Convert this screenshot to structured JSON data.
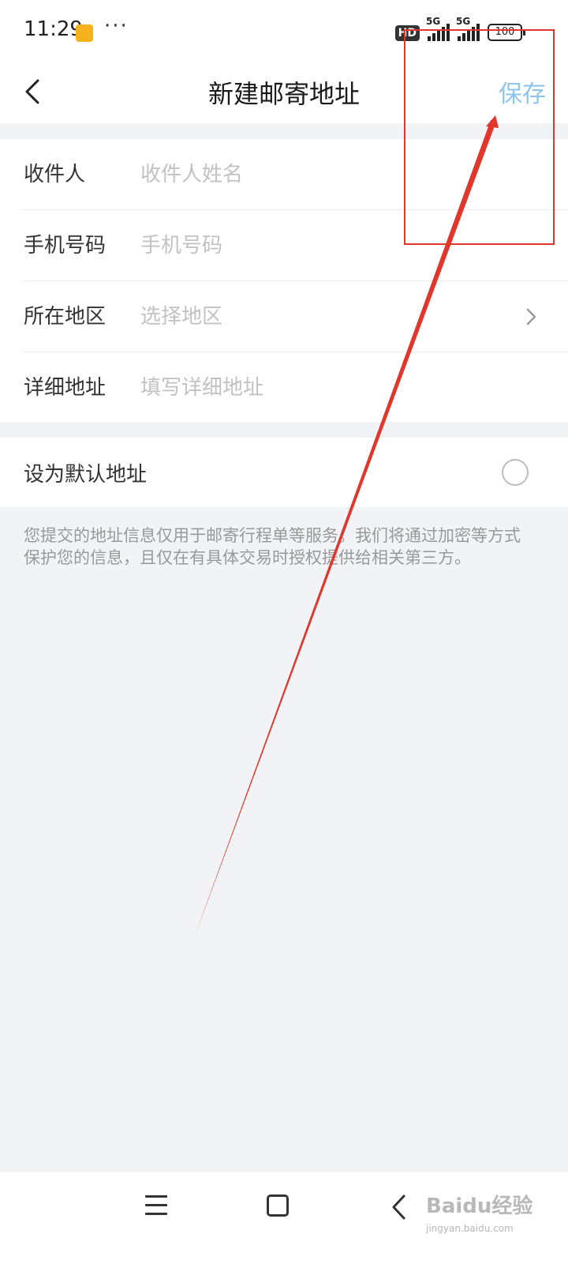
{
  "status_bar": {
    "time": "11:29",
    "dots": "···",
    "hd": "HD",
    "signal1_tag": "5G",
    "signal2_tag": "5G",
    "battery": "100"
  },
  "header": {
    "title": "新建邮寄地址",
    "save_label": "保存"
  },
  "form": {
    "rows": [
      {
        "label": "收件人",
        "placeholder": "收件人姓名"
      },
      {
        "label": "手机号码",
        "placeholder": "手机号码"
      },
      {
        "label": "所在地区",
        "placeholder": "选择地区"
      },
      {
        "label": "详细地址",
        "placeholder": "填写详细地址"
      }
    ]
  },
  "default_address": {
    "label": "设为默认地址",
    "checked": false
  },
  "notice": "您提交的地址信息仅用于邮寄行程单等服务。我们将通过加密等方式保护您的信息，且仅在有具体交易时授权提供给相关第三方。",
  "watermark": {
    "main": "Baidu经验",
    "sub": "jingyan.baidu.com"
  },
  "colors": {
    "save": "#8ec5ea",
    "annotation": "#e0362c",
    "background": "#f2f3f6"
  }
}
